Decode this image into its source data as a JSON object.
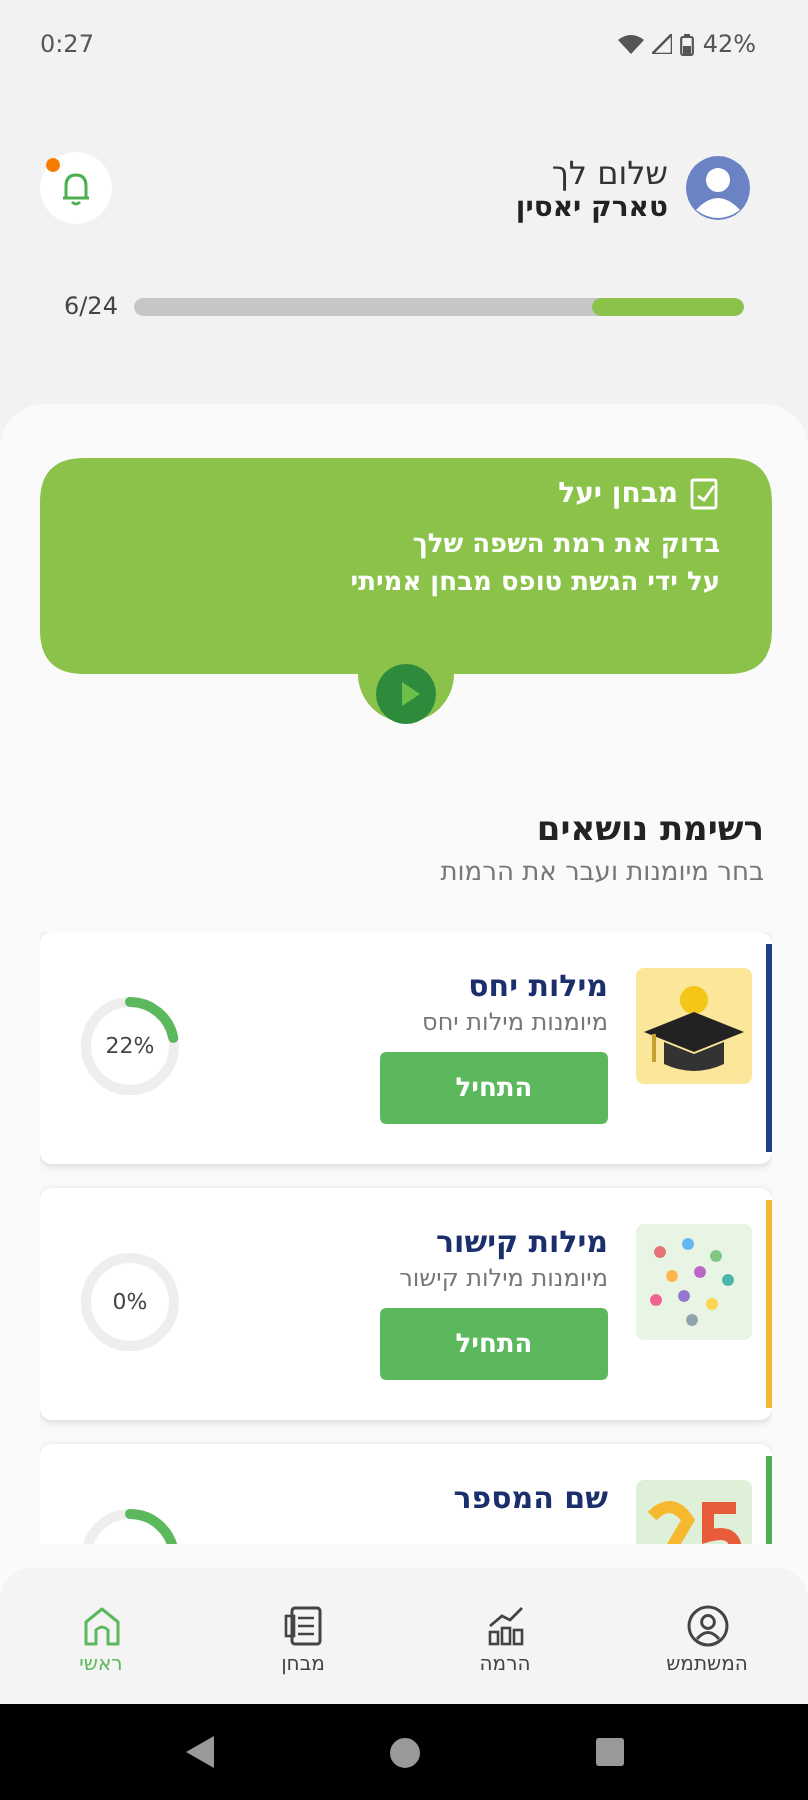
{
  "status_bar": {
    "time": "0:27",
    "battery": "42%"
  },
  "header": {
    "greeting": "שלום לך",
    "user_name": "טארק יאסין",
    "has_notification": true
  },
  "progress": {
    "label": "6/24",
    "level": 0.25
  },
  "banner": {
    "title": "מבחן יעל",
    "lines": [
      "בדוק את רמת השפה שלך",
      "על ידי הגשת טופס מבחן אמיתי"
    ]
  },
  "topics_section": {
    "title": "רשימת נושאים",
    "subtitle": "בחר מיומנות ועבר את הרמות"
  },
  "topics": [
    {
      "kind": "cap",
      "title": "מילות יחס",
      "subtitle": "מיומנות מילות יחס",
      "button": "התחיל",
      "percent": "22%",
      "color": "#1f3f8f"
    },
    {
      "kind": "dots",
      "title": "מילות קישור",
      "subtitle": "מיומנות מילות קישור",
      "button": "התחיל",
      "percent": "0%",
      "color": "#f2b632"
    },
    {
      "kind": "numbers",
      "title": "שם המספר",
      "color": "#4caf50"
    }
  ],
  "bottom_nav": [
    {
      "kind": "user",
      "label": "המשתמש",
      "selected": false
    },
    {
      "kind": "chart",
      "label": "הרמה",
      "selected": false
    },
    {
      "kind": "test",
      "label": "מבחן",
      "selected": false
    },
    {
      "kind": "home",
      "label": "ראשי",
      "selected": true
    }
  ]
}
